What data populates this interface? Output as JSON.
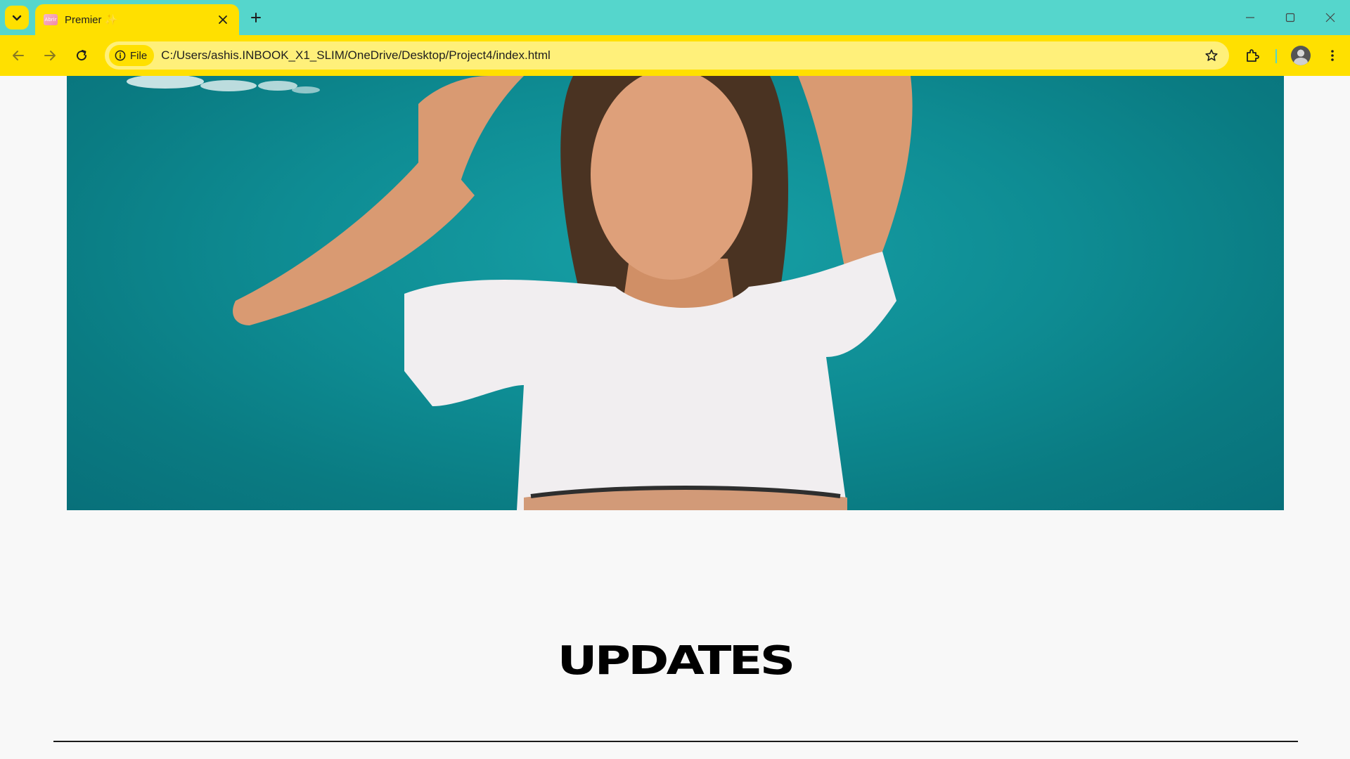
{
  "browser": {
    "tab": {
      "title": "Premier ✨",
      "favicon_text": "Abrir"
    },
    "omnibox": {
      "chip_label": "File",
      "url": "C:/Users/ashis.INBOOK_X1_SLIM/OneDrive/Desktop/Project4/index.html"
    },
    "icons": {
      "tab_search": "chevron-down-icon",
      "close_tab": "close-icon",
      "new_tab": "plus-icon",
      "minimize": "minimize-icon",
      "maximize": "maximize-icon",
      "close_window": "close-icon",
      "back": "arrow-left-icon",
      "forward": "arrow-right-icon",
      "reload": "reload-icon",
      "site_info": "info-icon",
      "bookmark": "star-icon",
      "extensions": "puzzle-icon",
      "profile": "avatar-icon",
      "menu": "kebab-icon"
    },
    "colors": {
      "tabstrip": "#55d6cc",
      "toolbar": "#ffe000",
      "omnibox": "#fff07a"
    }
  },
  "page": {
    "hero": {
      "sky_color": "#0e8c93"
    },
    "updates": {
      "title": "UPDATES"
    }
  }
}
